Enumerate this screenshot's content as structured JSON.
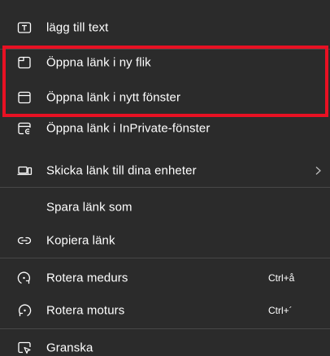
{
  "menu": {
    "add_text": "lägg till text",
    "open_new_tab": "Öppna länk i ny flik",
    "open_new_window": "Öppna länk i nytt fönster",
    "open_inprivate": "Öppna länk i InPrivate-fönster",
    "send_to_devices": "Skicka länk till dina enheter",
    "save_link_as": "Spara länk som",
    "copy_link": "Kopiera länk",
    "rotate_cw": "Rotera medurs",
    "rotate_cw_shortcut": "Ctrl+å",
    "rotate_ccw": "Rotera moturs",
    "rotate_ccw_shortcut": "Ctrl+´",
    "inspect": "Granska"
  },
  "icons": {
    "add_text": "text-box-icon",
    "open_new_tab": "new-tab-icon",
    "open_new_window": "new-window-icon",
    "open_inprivate": "inprivate-window-icon",
    "send_to_devices": "devices-icon",
    "copy_link": "link-icon",
    "rotate_cw": "rotate-clockwise-icon",
    "rotate_ccw": "rotate-counterclockwise-icon",
    "inspect": "inspect-icon",
    "submenu": "chevron-right-icon"
  },
  "colors": {
    "background": "#2b2b2b",
    "text": "#ffffff",
    "divider": "#474747",
    "highlight_border": "#e81123"
  }
}
